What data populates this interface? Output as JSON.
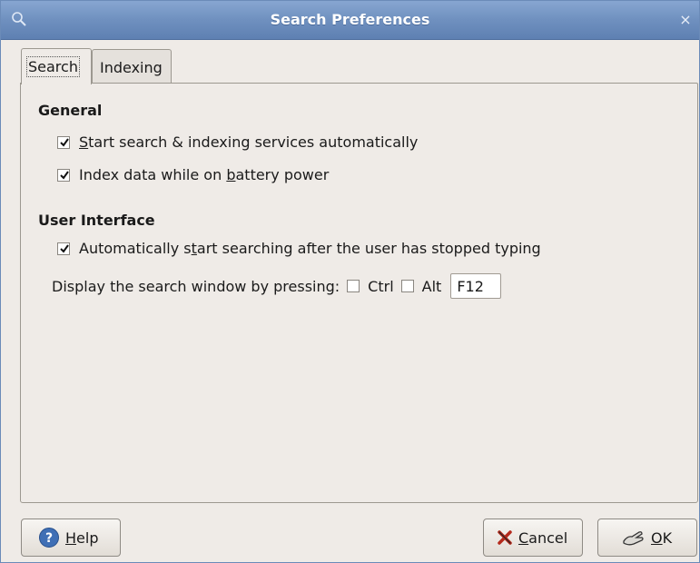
{
  "window": {
    "title": "Search Preferences",
    "close_glyph": "×",
    "icon": "search-icon"
  },
  "tabs": [
    {
      "label": "Search",
      "active": true
    },
    {
      "label": "Indexing",
      "active": false
    }
  ],
  "general": {
    "heading": "General",
    "start_services": {
      "pre": "",
      "mnemonic": "S",
      "post": "tart search & indexing services automatically",
      "checked": true
    },
    "battery": {
      "pre": "Index data while on ",
      "mnemonic": "b",
      "post": "attery power",
      "checked": true
    }
  },
  "ui": {
    "heading": "User Interface",
    "auto_search": {
      "pre": "Automatically s",
      "mnemonic": "t",
      "post": "art searching after the user has stopped typing",
      "checked": true
    },
    "hotkey": {
      "label": "Display the search window by pressing:",
      "ctrl_label": "Ctrl",
      "ctrl_checked": false,
      "alt_label": "Alt",
      "alt_checked": false,
      "key_value": "F12"
    }
  },
  "buttons": {
    "help": {
      "mnemonic": "H",
      "rest": "elp",
      "icon": "help-icon"
    },
    "cancel": {
      "mnemonic": "C",
      "rest": "ancel",
      "icon": "cancel-x-icon"
    },
    "ok": {
      "mnemonic": "O",
      "rest": "K",
      "icon": "ok-hand-icon"
    }
  },
  "colors": {
    "titlebar": "#6f90bf",
    "background": "#efebe7"
  }
}
